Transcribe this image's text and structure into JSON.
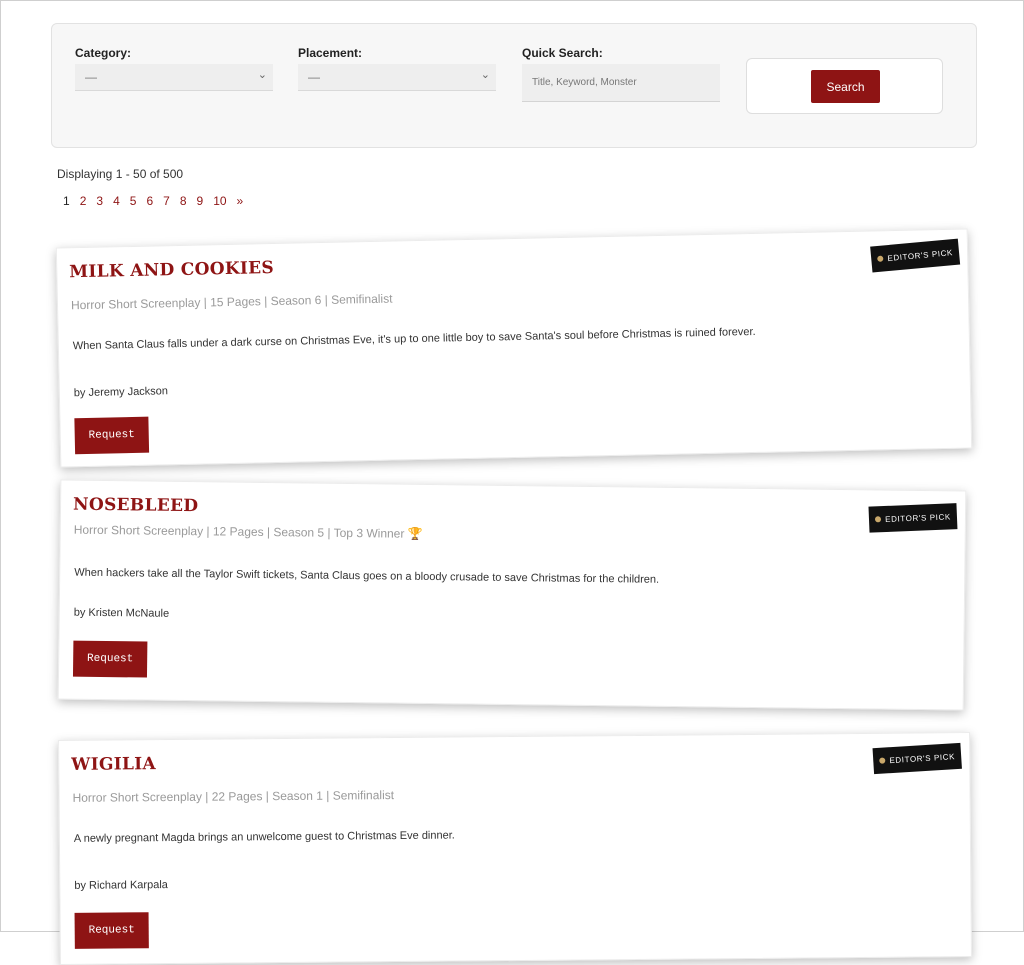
{
  "filters": {
    "category_label": "Category:",
    "category_value": "—",
    "placement_label": "Placement:",
    "placement_value": "—",
    "quick_search_label": "Quick Search:",
    "quick_search_placeholder": "Title, Keyword, Monster",
    "search_button": "Search"
  },
  "results": {
    "displaying": "Displaying 1 - 50 of 500",
    "pages": [
      "1",
      "2",
      "3",
      "4",
      "5",
      "6",
      "7",
      "8",
      "9",
      "10",
      "»"
    ]
  },
  "cards": [
    {
      "title": "MILK AND COOKIES",
      "meta": "Horror Short Screenplay | 15 Pages | Season 6 | Semifinalist",
      "logline": "When Santa Claus falls under a dark curse on Christmas Eve, it's up to one little boy to save Santa's soul before Christmas is ruined forever.",
      "author": "by Jeremy Jackson",
      "request_label": "Request",
      "badge": "EDITOR'S PICK"
    },
    {
      "title": "NOSEBLEED",
      "meta": "Horror Short Screenplay | 12 Pages | Season 5 | Top 3 Winner 🏆",
      "logline": "When hackers take all the Taylor Swift tickets, Santa Claus goes on a bloody crusade to save Christmas for the children.",
      "author": "by Kristen McNaule",
      "request_label": "Request",
      "badge": "EDITOR'S PICK"
    },
    {
      "title": "WIGILIA",
      "meta": "Horror Short Screenplay | 22 Pages | Season 1 | Semifinalist",
      "logline": "A newly pregnant Magda brings an unwelcome guest to Christmas Eve dinner.",
      "author": "by Richard Karpala",
      "request_label": "Request",
      "badge": "EDITOR'S PICK"
    }
  ],
  "colors": {
    "accent": "#8e1414",
    "badge_bg": "#111111"
  }
}
